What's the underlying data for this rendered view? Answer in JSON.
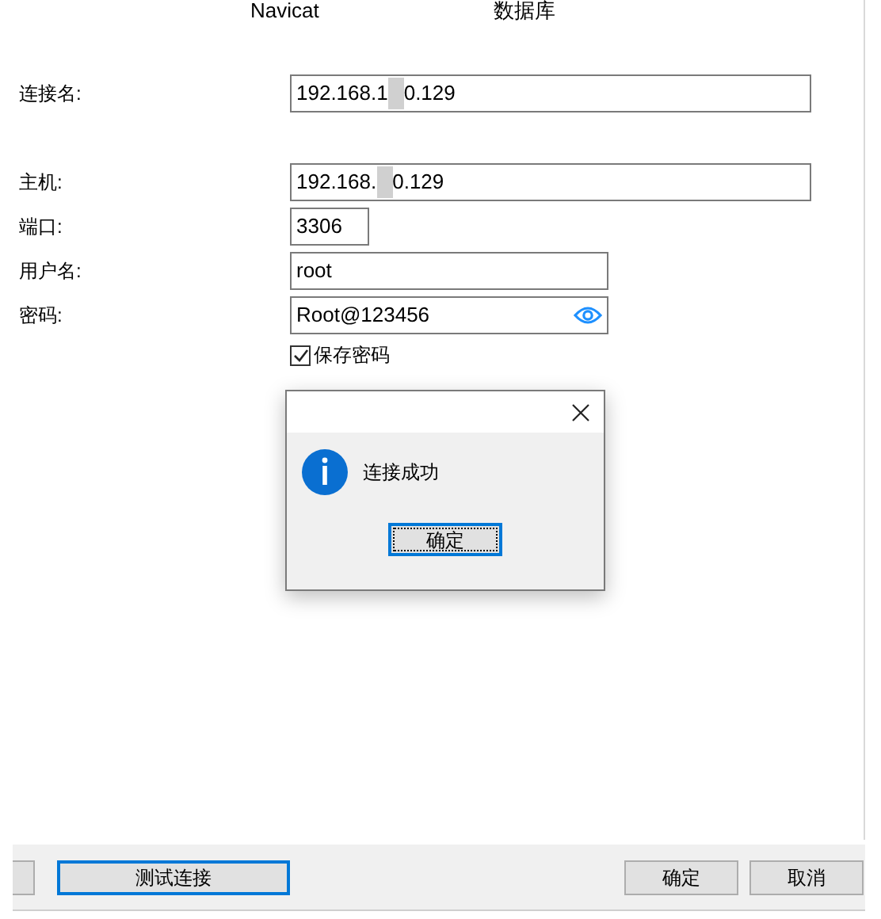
{
  "tabs": [
    {
      "label": "Navicat"
    },
    {
      "label": "数据库"
    }
  ],
  "fields": [
    {
      "kind": "text",
      "label": "连接名:",
      "value_start": "192.168.1",
      "value_end": "0.129",
      "redacted": true
    },
    {
      "kind": "text",
      "label": "主机:",
      "value_start": "192.168.",
      "value_end": "0.129",
      "redacted": true
    },
    {
      "kind": "text",
      "label": "端口:",
      "value_start": "3306",
      "redacted": false
    },
    {
      "kind": "text",
      "label": "用户名:",
      "value_start": "root",
      "redacted": false
    },
    {
      "kind": "password",
      "label": "密码:",
      "value_start": "Root@123456",
      "redacted": false
    }
  ],
  "save_password": {
    "label": "保存密码",
    "checked": true
  },
  "dialog": {
    "message": "连接成功",
    "button": "确定"
  },
  "footer": {
    "test_button": "测试连接",
    "ok_button": "确定",
    "cancel_button": "取消"
  }
}
